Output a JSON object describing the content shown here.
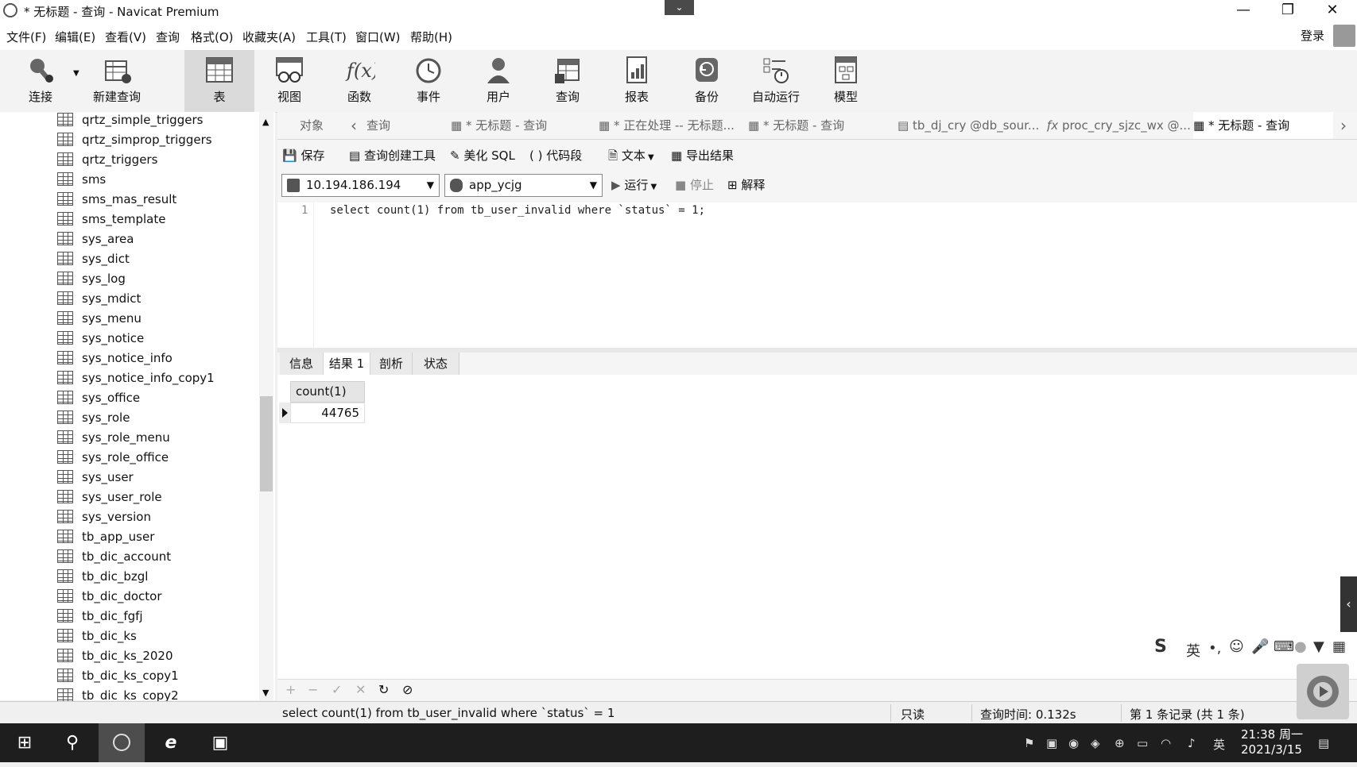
{
  "window": {
    "title": "* 无标题 - 查询 - Navicat Premium",
    "dropdown_glyph": "⌄",
    "minimize": "—",
    "restore": "❐",
    "close": "✕"
  },
  "menu": {
    "items": [
      "文件(F)",
      "编辑(E)",
      "查看(V)",
      "查询",
      "格式(O)",
      "收藏夹(A)",
      "工具(T)",
      "窗口(W)",
      "帮助(H)"
    ],
    "login": "登录"
  },
  "toolbar": {
    "tools": [
      {
        "label": "连接",
        "icon": "plug-icon"
      },
      {
        "label": "新建查询",
        "icon": "new-query-icon"
      },
      {
        "label": "表",
        "icon": "table-icon",
        "active": true
      },
      {
        "label": "视图",
        "icon": "view-icon"
      },
      {
        "label": "函数",
        "icon": "function-icon"
      },
      {
        "label": "事件",
        "icon": "clock-icon"
      },
      {
        "label": "用户",
        "icon": "user-icon"
      },
      {
        "label": "查询",
        "icon": "query-icon"
      },
      {
        "label": "报表",
        "icon": "report-icon"
      },
      {
        "label": "备份",
        "icon": "backup-icon"
      },
      {
        "label": "自动运行",
        "icon": "schedule-icon"
      },
      {
        "label": "模型",
        "icon": "model-icon"
      }
    ]
  },
  "tree": {
    "items": [
      "qrtz_simple_triggers",
      "qrtz_simprop_triggers",
      "qrtz_triggers",
      "sms",
      "sms_mas_result",
      "sms_template",
      "sys_area",
      "sys_dict",
      "sys_log",
      "sys_mdict",
      "sys_menu",
      "sys_notice",
      "sys_notice_info",
      "sys_notice_info_copy1",
      "sys_office",
      "sys_role",
      "sys_role_menu",
      "sys_role_office",
      "sys_user",
      "sys_user_role",
      "sys_version",
      "tb_app_user",
      "tb_dic_account",
      "tb_dic_bzgl",
      "tb_dic_doctor",
      "tb_dic_fgfj",
      "tb_dic_ks",
      "tb_dic_ks_2020",
      "tb_dic_ks_copy1",
      "tb_dic_ks_copy2"
    ]
  },
  "tabs": {
    "objects": "对象",
    "items": [
      "查询",
      "* 无标题 - 查询",
      "* 正在处理 -- 无标题...",
      "* 无标题 - 查询",
      "tb_dj_cry @db_sour...",
      "proc_cry_sjzc_wx @...",
      "* 无标题 - 查询"
    ],
    "prev_arrow": "‹",
    "next_arrow": "›"
  },
  "query_toolbar": {
    "save": "保存",
    "builder": "查询创建工具",
    "beautify": "美化 SQL",
    "snippet": "代码段",
    "text": "文本",
    "export": "导出结果"
  },
  "connection": {
    "host": "10.194.186.194",
    "database": "app_ycjg",
    "run": "运行",
    "stop": "停止",
    "explain": "解释"
  },
  "editor": {
    "line_number": "1",
    "sql": "select count(1) from tb_user_invalid where `status` = 1;"
  },
  "result_tabs": [
    "信息",
    "结果 1",
    "剖析",
    "状态"
  ],
  "grid": {
    "column": "count(1)",
    "value": "44765"
  },
  "grid_footer": [
    "+",
    "−",
    "✓",
    "✕",
    "↻",
    "⊘"
  ],
  "status": {
    "sql": "select count(1) from tb_user_invalid where `status` = 1",
    "readonly": "只读",
    "query_time": "查询时间: 0.132s",
    "records": "第 1 条记录 (共 1 条)"
  },
  "ime": {
    "lang": "英",
    "punct": "•,",
    "sidetab_arrow": "‹"
  },
  "taskbar": {
    "start_glyph": "⊞",
    "search_glyph": "⚲",
    "tray_lang": "英",
    "time": "21:38 周一",
    "date": "2021/3/15"
  }
}
